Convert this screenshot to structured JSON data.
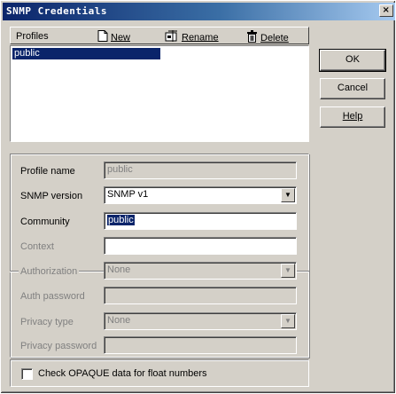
{
  "window": {
    "title": "SNMP Credentials",
    "close_glyph": "×"
  },
  "toolbar": {
    "profiles_label": "Profiles",
    "new_label": "New",
    "rename_label": "Rename",
    "delete_label": "Delete"
  },
  "profiles_list": {
    "items": [
      "public"
    ],
    "selected_index": 0
  },
  "buttons": {
    "ok": "OK",
    "cancel": "Cancel",
    "help": "Help"
  },
  "form": {
    "profile_name": {
      "label": "Profile name",
      "value": "public"
    },
    "snmp_version": {
      "label": "SNMP version",
      "value": "SNMP v1"
    },
    "community": {
      "label": "Community",
      "value": "public"
    },
    "context": {
      "label": "Context",
      "value": ""
    },
    "authorization": {
      "label": "Authorization",
      "value": "None"
    },
    "auth_password": {
      "label": "Auth password",
      "value": ""
    },
    "privacy_type": {
      "label": "Privacy type",
      "value": "None"
    },
    "privacy_password": {
      "label": "Privacy password",
      "value": ""
    }
  },
  "options": {
    "check_opaque_label": "Check OPAQUE data for float numbers",
    "check_opaque_checked": false
  },
  "icons": {
    "new": "new-document-icon",
    "rename": "rename-icon",
    "delete": "trash-icon",
    "combo_arrow": "chevron-down-icon"
  },
  "colors": {
    "titlebar_start": "#0a246a",
    "titlebar_end": "#a6caf0",
    "selection": "#0a246a",
    "face": "#d4d0c8"
  }
}
